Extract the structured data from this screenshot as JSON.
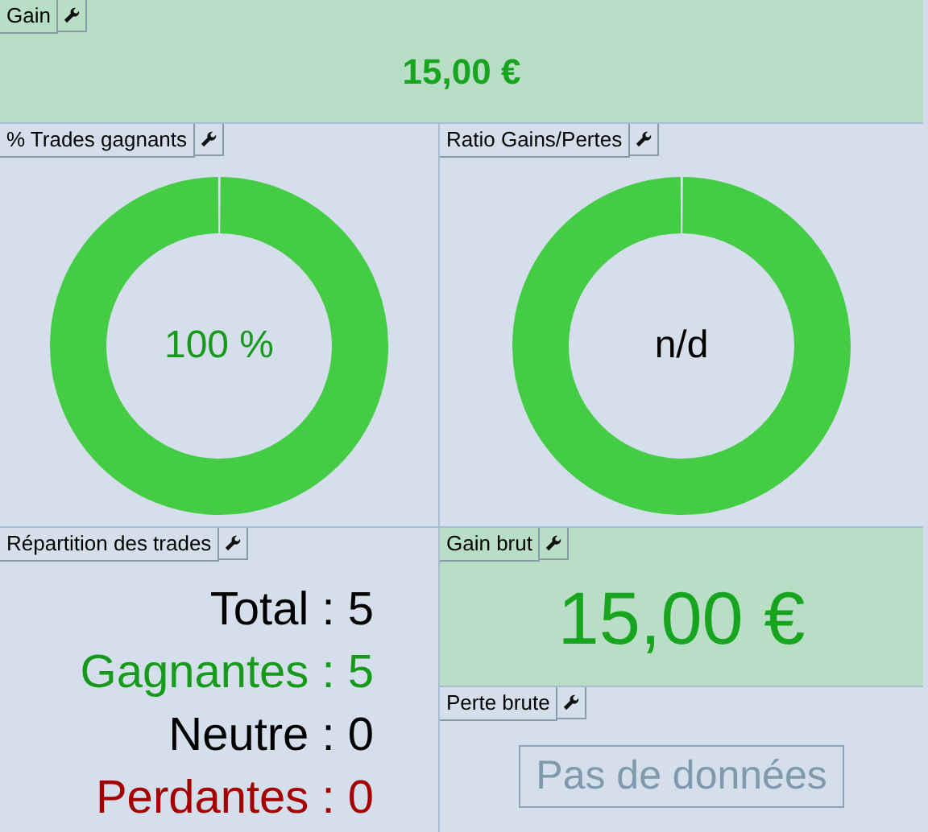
{
  "panels": [
    {
      "kind": "value",
      "title": "Gain",
      "highlight": true,
      "value": "15,00 €"
    },
    {
      "kind": "donut",
      "title": "% Trades gagnants",
      "highlight": false,
      "value": "100 %",
      "color": "#17991b"
    },
    {
      "kind": "donut",
      "title": "Ratio Gains/Pertes",
      "highlight": false,
      "value": "n/d",
      "color": "#000000"
    },
    {
      "kind": "stats",
      "title": "Répartition des trades",
      "highlight": false,
      "lines": [
        {
          "label": "Total :",
          "value": "5",
          "color": "#000000"
        },
        {
          "label": "Gagnantes :",
          "value": "5",
          "color": "#17991b"
        },
        {
          "label": "Neutre :",
          "value": "0",
          "color": "#000000"
        },
        {
          "label": "Perdantes :",
          "value": "0",
          "color": "#a30000"
        }
      ]
    },
    {
      "kind": "big_value",
      "title": "Gain brut",
      "highlight": true,
      "value": "15,00 €"
    },
    {
      "kind": "empty",
      "title": "Perte brute",
      "highlight": false,
      "message": "Pas de données"
    }
  ]
}
